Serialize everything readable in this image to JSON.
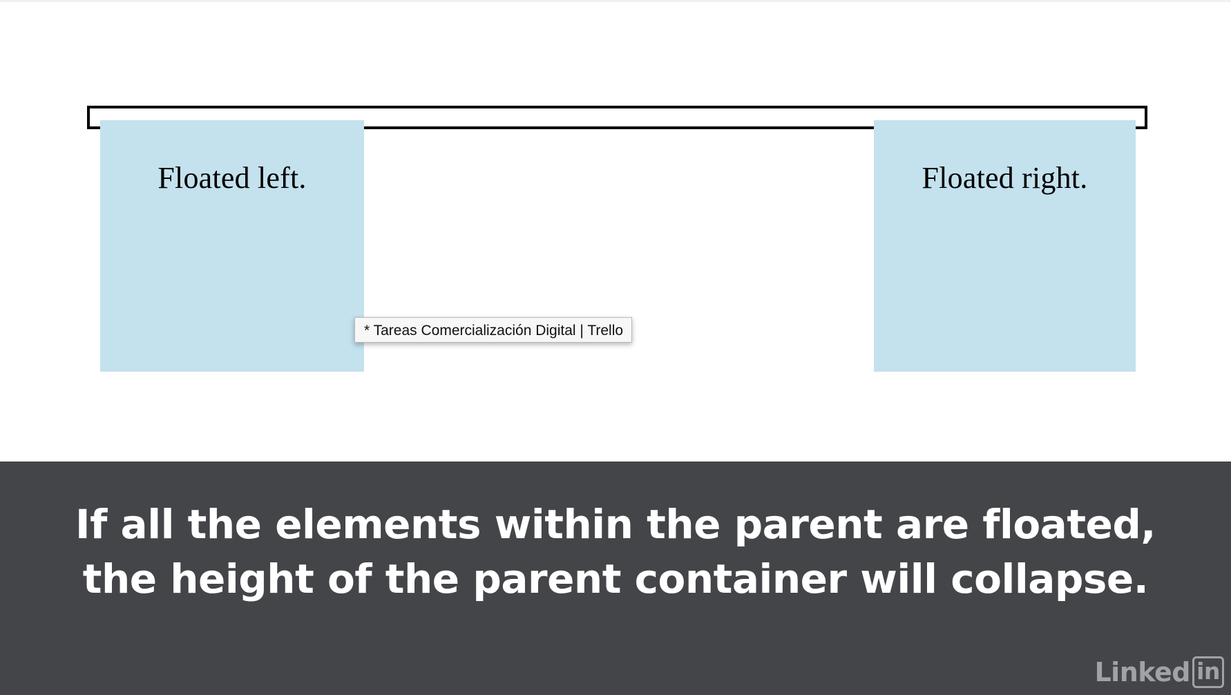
{
  "demo": {
    "left_box_text": "Floated left.",
    "right_box_text": "Floated right."
  },
  "tooltip": {
    "text": "* Tareas Comercialización Digital | Trello"
  },
  "caption": {
    "line1": "If all the elements within the parent are floated,",
    "line2": "the height of the parent container will collapse."
  },
  "watermark": {
    "brand_text": "Linked",
    "brand_badge": "in"
  },
  "colors": {
    "float_box_bg": "#c4e1ee",
    "caption_bg": "#434549",
    "parent_border": "#000000"
  }
}
